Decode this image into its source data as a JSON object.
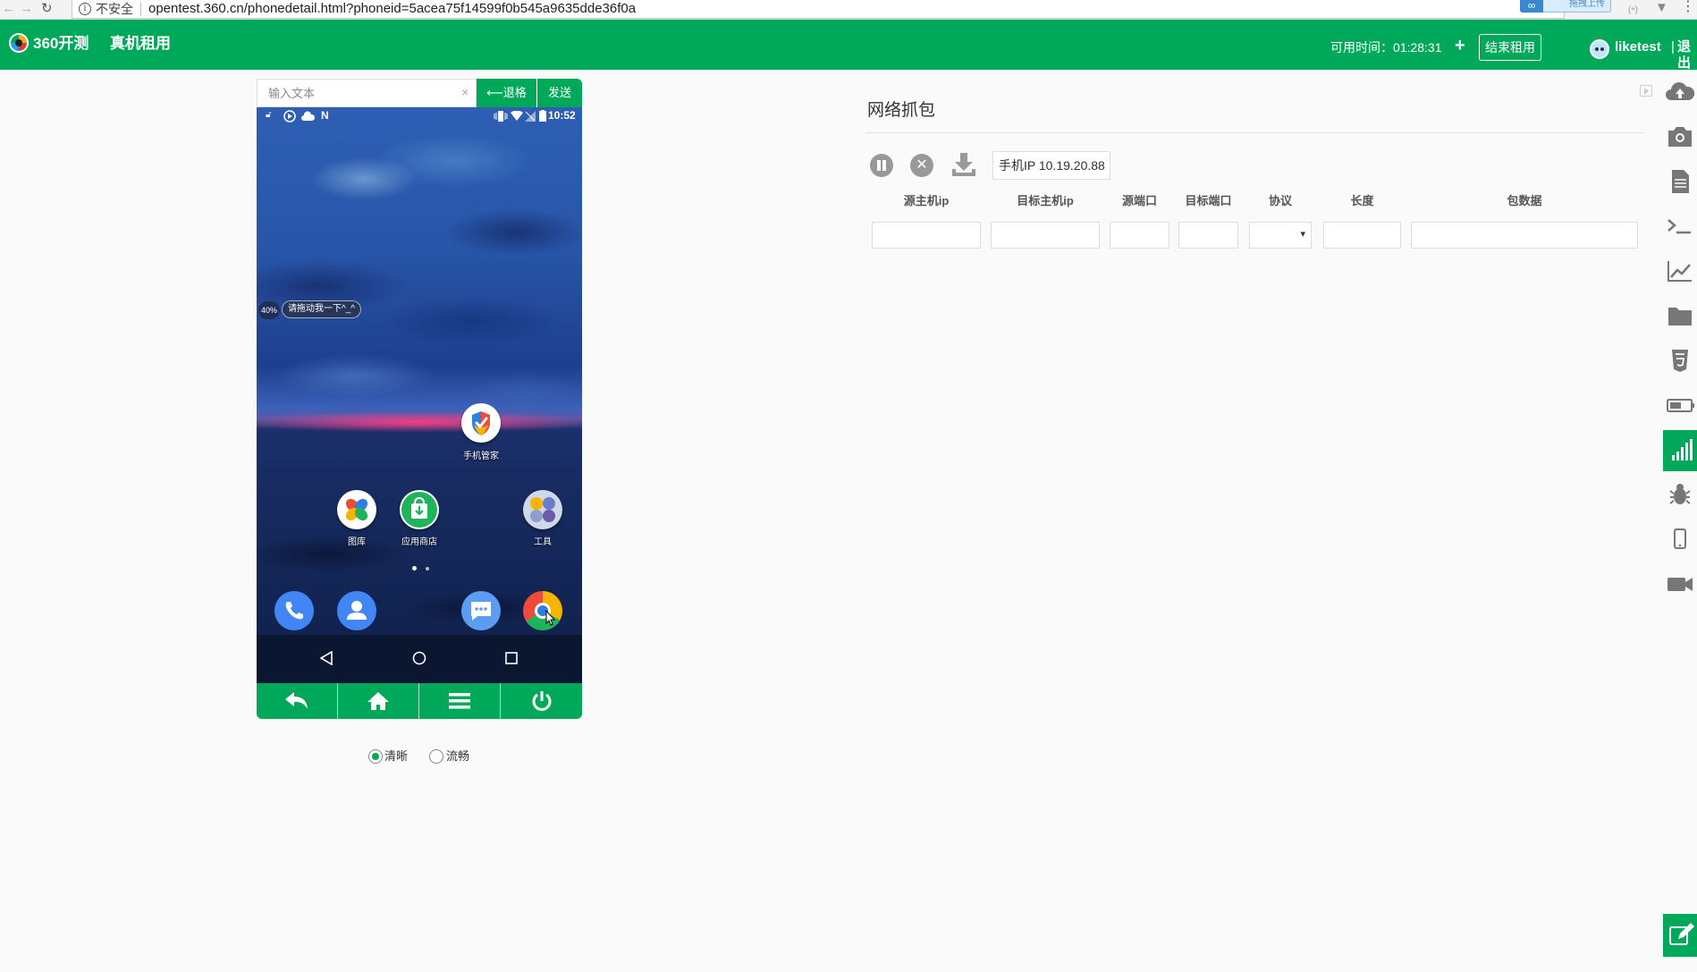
{
  "browser": {
    "insecure_label": "不安全",
    "url": "opentest.360.cn/phonedetail.html?phoneid=5acea75f14599f0b545a9635dde36f0a",
    "ext_badge": "拖拽上传"
  },
  "header": {
    "brand": "360开测",
    "nav_rent": "真机租用",
    "available_time": "可用时间：01:28:31",
    "plus": "+",
    "end_rent": "结束租用",
    "username": "liketest",
    "separator": "|",
    "logout": "退出"
  },
  "phone": {
    "input_placeholder": "输入文本",
    "clear": "×",
    "backspace": "⟵退格",
    "send": "发送",
    "status_time": "10:52",
    "float_percent": "40%",
    "float_tip": "请拖动我一下^_^",
    "apps": {
      "manager": "手机管家",
      "gallery": "图库",
      "store": "应用商店",
      "tools": "工具"
    }
  },
  "quality": {
    "options": [
      "清晰",
      "流畅"
    ],
    "selected": "清晰"
  },
  "capture": {
    "title": "网络抓包",
    "phone_ip": "手机IP 10.19.20.88",
    "columns": [
      "源主机ip",
      "目标主机ip",
      "源端口",
      "目标端口",
      "协议",
      "长度",
      "包数据"
    ]
  },
  "colors": {
    "brand_green": "#00a85a"
  },
  "sidebar_icons": [
    "upload-icon",
    "camera-icon",
    "document-icon",
    "terminal-icon",
    "chart-icon",
    "folder-icon",
    "html5-icon",
    "battery-icon",
    "signal-icon",
    "bug-icon",
    "phone-icon",
    "video-icon",
    "edit-icon"
  ]
}
